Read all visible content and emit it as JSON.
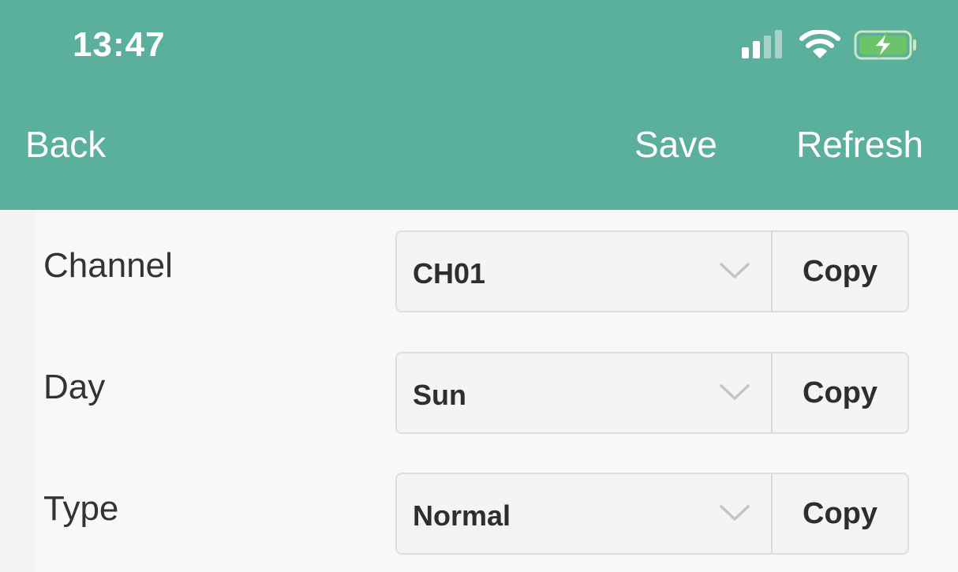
{
  "status_bar": {
    "time": "13:47",
    "icons": [
      "cellular-signal-icon",
      "wifi-icon",
      "battery-charging-icon"
    ]
  },
  "nav": {
    "back_label": "Back",
    "save_label": "Save",
    "refresh_label": "Refresh"
  },
  "form": {
    "rows": [
      {
        "label": "Channel",
        "value": "CH01",
        "copy_label": "Copy"
      },
      {
        "label": "Day",
        "value": "Sun",
        "copy_label": "Copy"
      },
      {
        "label": "Type",
        "value": "Normal",
        "copy_label": "Copy"
      }
    ]
  },
  "colors": {
    "header": "#5aaf9d",
    "background": "#f7f7f7",
    "battery_fill": "#6cc36a"
  }
}
